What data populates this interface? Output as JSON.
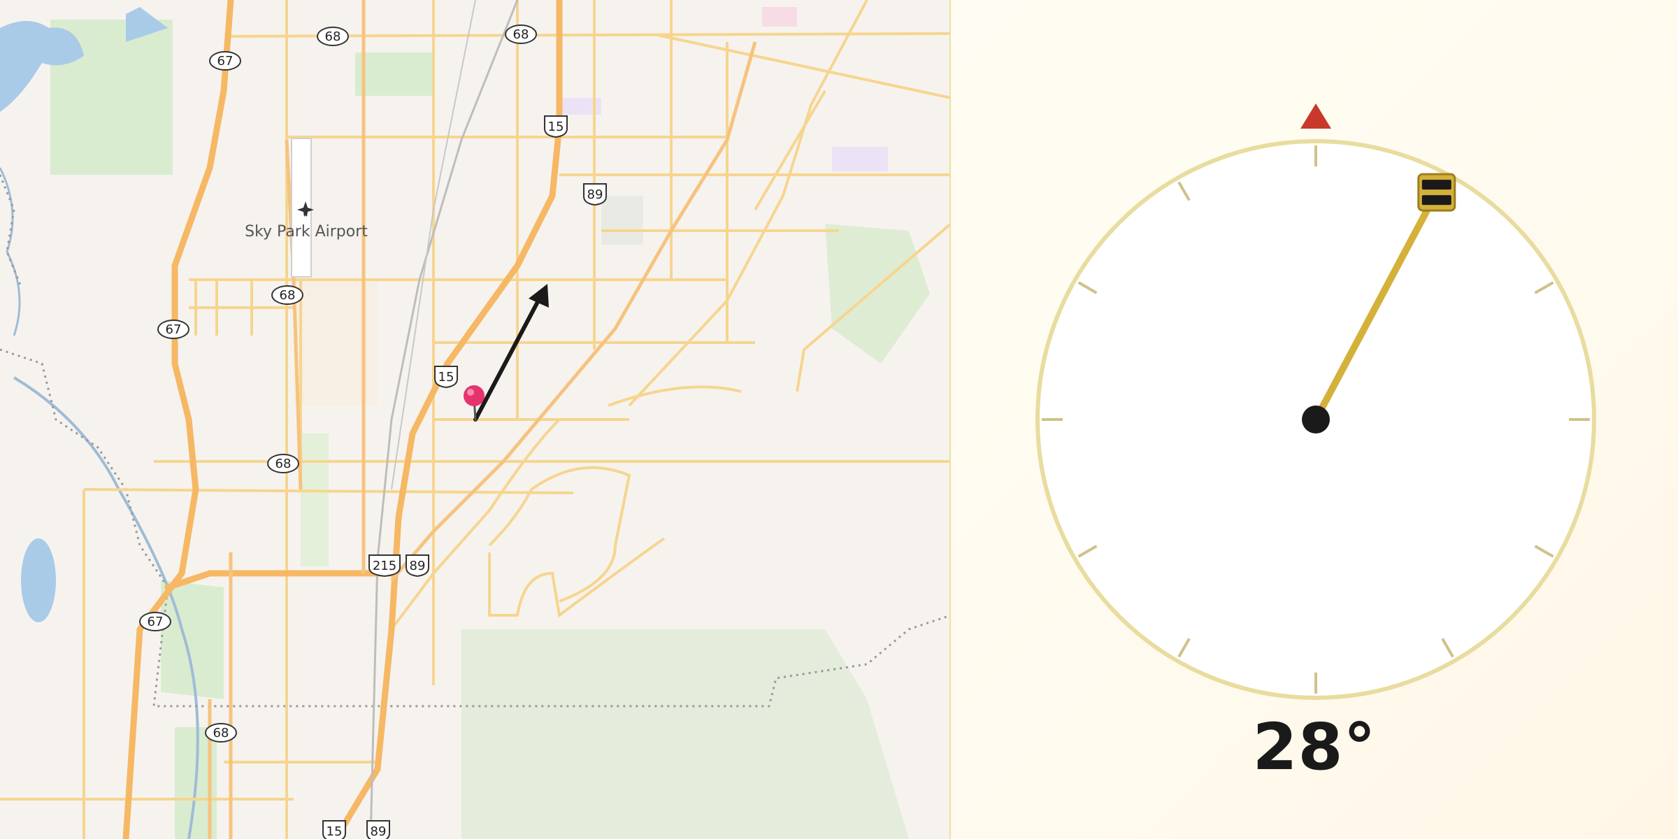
{
  "map": {
    "place_label": "Sky Park Airport",
    "shields": {
      "s68a": "68",
      "s68b": "68",
      "s68c": "68",
      "s68d": "68",
      "s68e": "68",
      "s67a": "67",
      "s67b": "67",
      "s67c": "67",
      "s15a": "15",
      "s15b": "15",
      "s15c": "15",
      "s89a": "89",
      "s89b": "89",
      "s89c": "89",
      "s215": "215"
    }
  },
  "compass": {
    "heading_deg": 28,
    "heading_text": "28°",
    "colors": {
      "needle": "#d4b13a",
      "north_marker": "#c8392b",
      "dial_ring": "#e8dc9f",
      "hub": "#1a1a1a"
    }
  },
  "icons": {
    "pin": "map-pin-icon",
    "arrow": "direction-arrow-icon",
    "airport": "airplane-icon",
    "north": "north-triangle-icon",
    "handle": "needle-handle-icon"
  }
}
